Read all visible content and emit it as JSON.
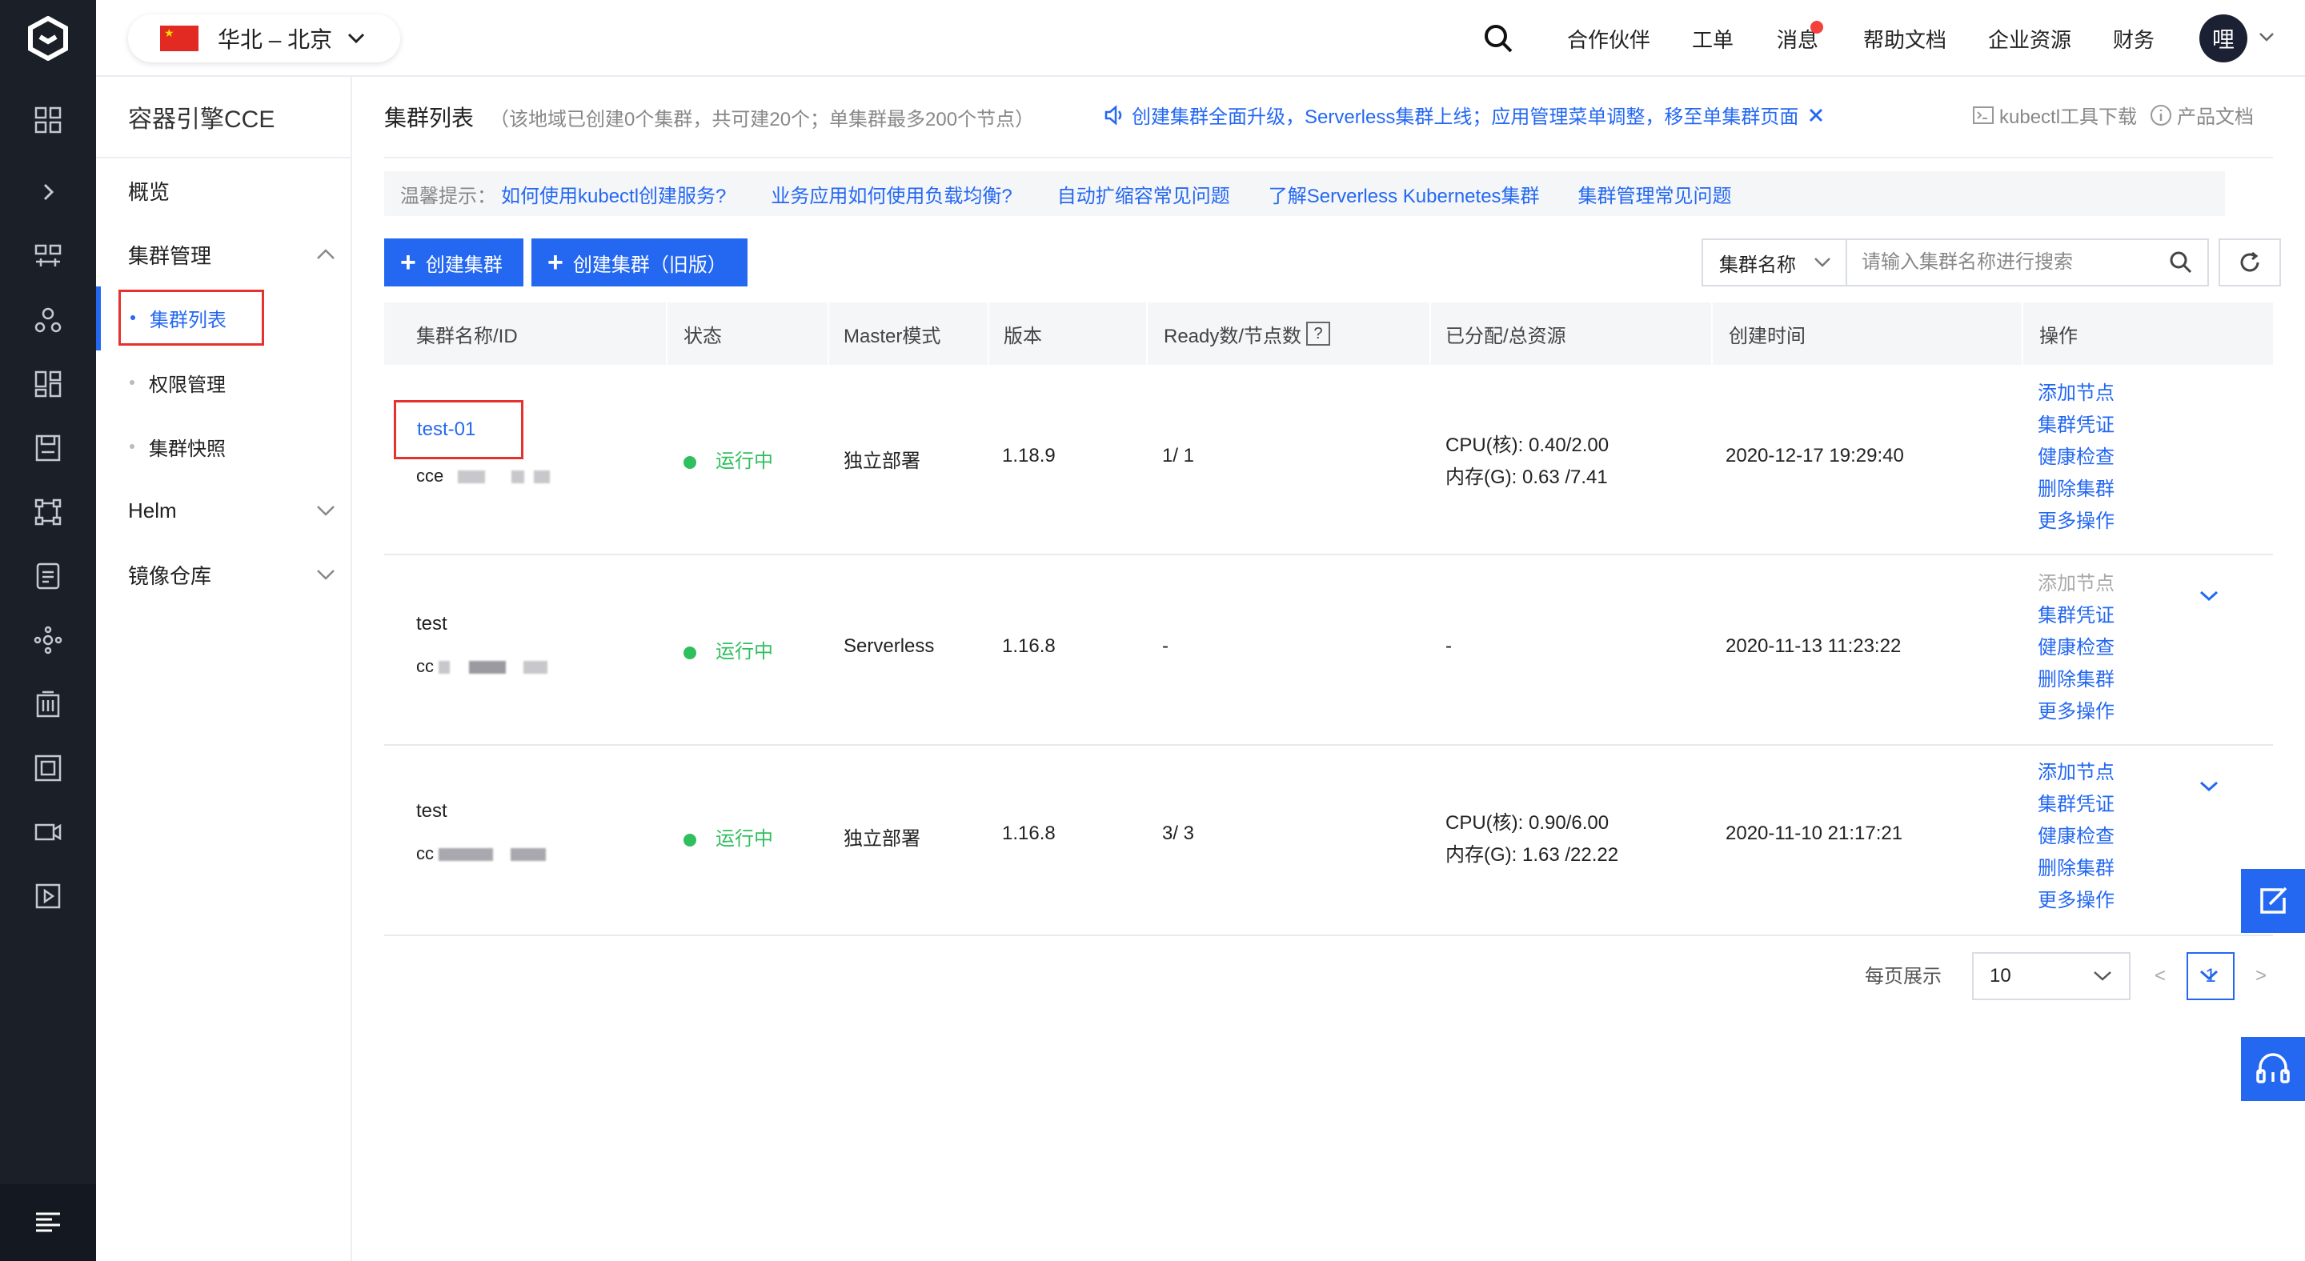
{
  "topbar": {
    "region": "华北 – 北京",
    "nav": [
      "合作伙伴",
      "工单",
      "消息",
      "帮助文档",
      "企业资源",
      "财务"
    ],
    "avatar_text": "哩"
  },
  "sidebar": {
    "title": "容器引擎CCE",
    "overview": "概览",
    "cluster_mgmt": "集群管理",
    "sub_items": [
      "集群列表",
      "权限管理",
      "集群快照"
    ],
    "helm": "Helm",
    "registry": "镜像仓库"
  },
  "header": {
    "title": "集群列表",
    "note": "（该地域已创建0个集群，共可建20个；单集群最多200个节点）",
    "announcement": "创建集群全面升级，Serverless集群上线；应用管理菜单调整，移至单集群页面",
    "kubectl_link": "kubectl工具下载",
    "docs_link": "产品文档"
  },
  "tips": {
    "label": "温馨提示：",
    "links": [
      "如何使用kubectl创建服务?",
      "业务应用如何使用负载均衡?",
      "自动扩缩容常见问题",
      "了解Serverless Kubernetes集群",
      "集群管理常见问题"
    ]
  },
  "toolbar": {
    "create": "创建集群",
    "create_old": "创建集群（旧版）",
    "search_field": "集群名称",
    "search_placeholder": "请输入集群名称进行搜索"
  },
  "table": {
    "columns": [
      "集群名称/ID",
      "状态",
      "Master模式",
      "版本",
      "Ready数/节点数",
      "已分配/总资源",
      "创建时间",
      "操作"
    ],
    "help_mark": "?",
    "rows": [
      {
        "name": "test-01",
        "id_prefix": "cce",
        "status": "运行中",
        "master": "独立部署",
        "version": "1.18.9",
        "nodes": "1/ 1",
        "cpu": "CPU(核): 0.40/2.00",
        "mem": "内存(G):  0.63 /7.41",
        "created": "2020-12-17 19:29:40"
      },
      {
        "name": "test",
        "id_prefix": "cc",
        "status": "运行中",
        "master": "Serverless",
        "version": "1.16.8",
        "nodes": "-",
        "cpu": "-",
        "mem": "",
        "created": "2020-11-13 11:23:22"
      },
      {
        "name": "test",
        "id_prefix": "cc",
        "status": "运行中",
        "master": "独立部署",
        "version": "1.16.8",
        "nodes": "3/ 3",
        "cpu": "CPU(核): 0.90/6.00",
        "mem": "内存(G):  1.63 /22.22",
        "created": "2020-11-10 21:17:21"
      }
    ],
    "ops": [
      "添加节点",
      "集群凭证",
      "健康检查",
      "删除集群",
      "更多操作"
    ]
  },
  "pager": {
    "label": "每页展示",
    "page_size": "10",
    "prev": "<",
    "current": "1",
    "next": ">"
  }
}
